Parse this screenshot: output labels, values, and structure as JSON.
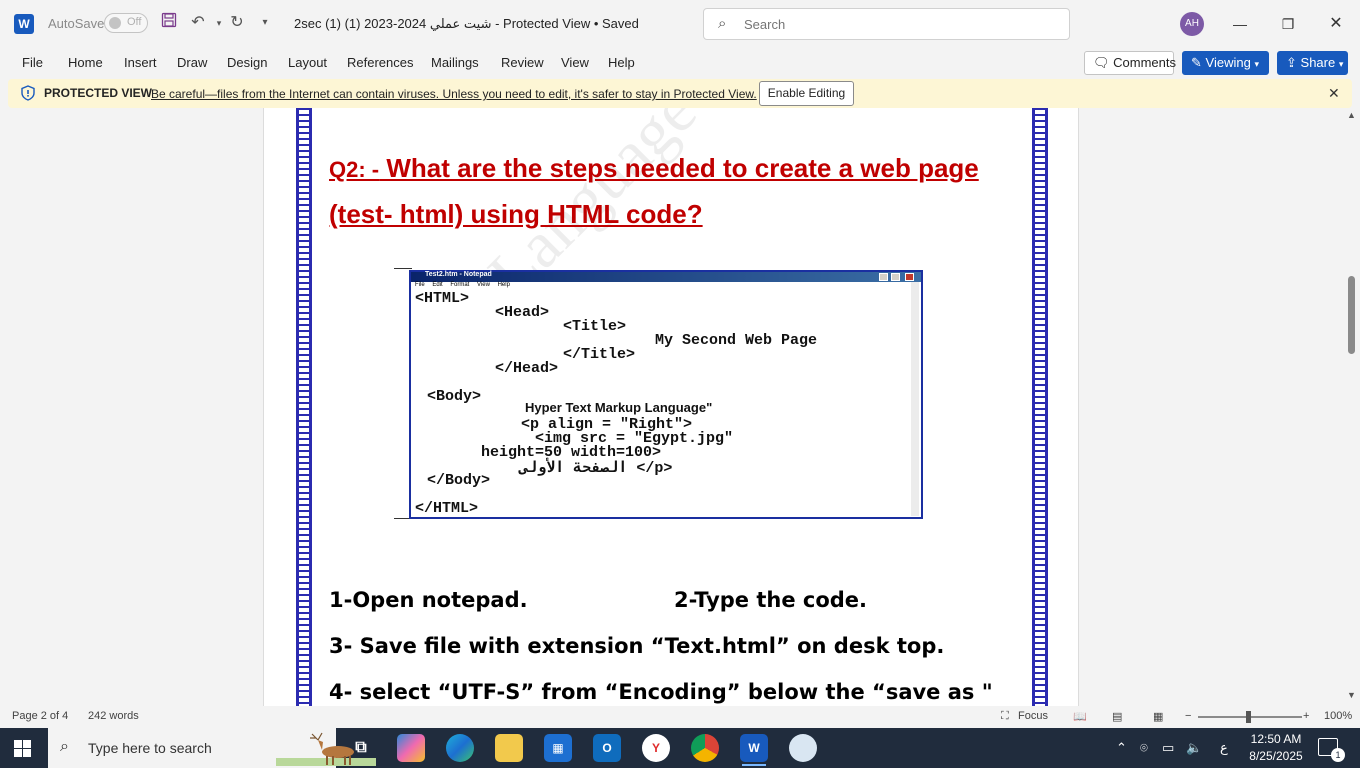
{
  "titlebar": {
    "app_letter": "W",
    "autosave_label": "AutoSave",
    "autosave_state": "Off",
    "document_title": "2sec (1) (1) 2023-2024 شيت عملي  -  Protected View • Saved",
    "search_placeholder": "Search",
    "avatar_initials": "AH",
    "icons": [
      "save-icon",
      "undo-icon",
      "redo-icon",
      "customize-icon",
      "search-icon",
      "minimize-icon",
      "restore-icon",
      "close-icon"
    ]
  },
  "menu": {
    "items": [
      "File",
      "Home",
      "Insert",
      "Draw",
      "Design",
      "Layout",
      "References",
      "Mailings",
      "Review",
      "View",
      "Help"
    ],
    "comments_label": "Comments",
    "viewing_label": "Viewing",
    "share_label": "Share"
  },
  "protected_view": {
    "label": "PROTECTED VIEW",
    "message": "Be careful—files from the Internet can contain viruses. Unless you need to edit, it's safer to stay in Protected View.",
    "enable_label": "Enable Editing"
  },
  "document": {
    "watermark": "Language School for Boys",
    "heading_line1_prefix": "Q2: -",
    "heading_line1": " What are the steps needed to create a web page",
    "heading_line2": "(test- html) using HTML code?",
    "notepad": {
      "window_title": "Test2.htm - Notepad",
      "menu": "File Edit Format View Help",
      "lines": [
        "<HTML>",
        "<Head>",
        "<Title>",
        "My Second Web Page",
        "</Title>",
        "</Head>",
        "<Body>",
        "Hyper Text Markup Language\"",
        "<p align = \"Right\">",
        "<img src = \"Egypt.jpg\"",
        "height=50 width=100>",
        "الصفحة الأولى  </p>",
        "</Body>",
        "</HTML>"
      ]
    },
    "step1": "1-Open notepad.",
    "step2": "2-Type the code.",
    "step3": "3- Save file with extension “Text.html” on desk top.",
    "step4": "4- select “UTF-S” from “Encoding” below the “save as \""
  },
  "statusbar": {
    "page": "Page 2 of 4",
    "words": "242 words",
    "focus": "Focus",
    "zoom": "100%",
    "zoom_level": 1.0
  },
  "taskbar": {
    "search_placeholder": "Type here to search",
    "apps": [
      "task-view-icon",
      "copilot-icon",
      "edge-icon",
      "file-explorer-icon",
      "store-icon",
      "outlook-icon",
      "yandex-icon",
      "chrome-icon",
      "word-icon",
      "paint-icon"
    ],
    "lang": "ع",
    "time": "12:50 AM",
    "date": "8/25/2025",
    "notifications": "1"
  },
  "colors": {
    "accent": "#185abd",
    "heading_red": "#c00000",
    "border_blue": "#2b2bb0",
    "protected_bar": "#fdf6d5",
    "taskbar": "#202c3d"
  }
}
